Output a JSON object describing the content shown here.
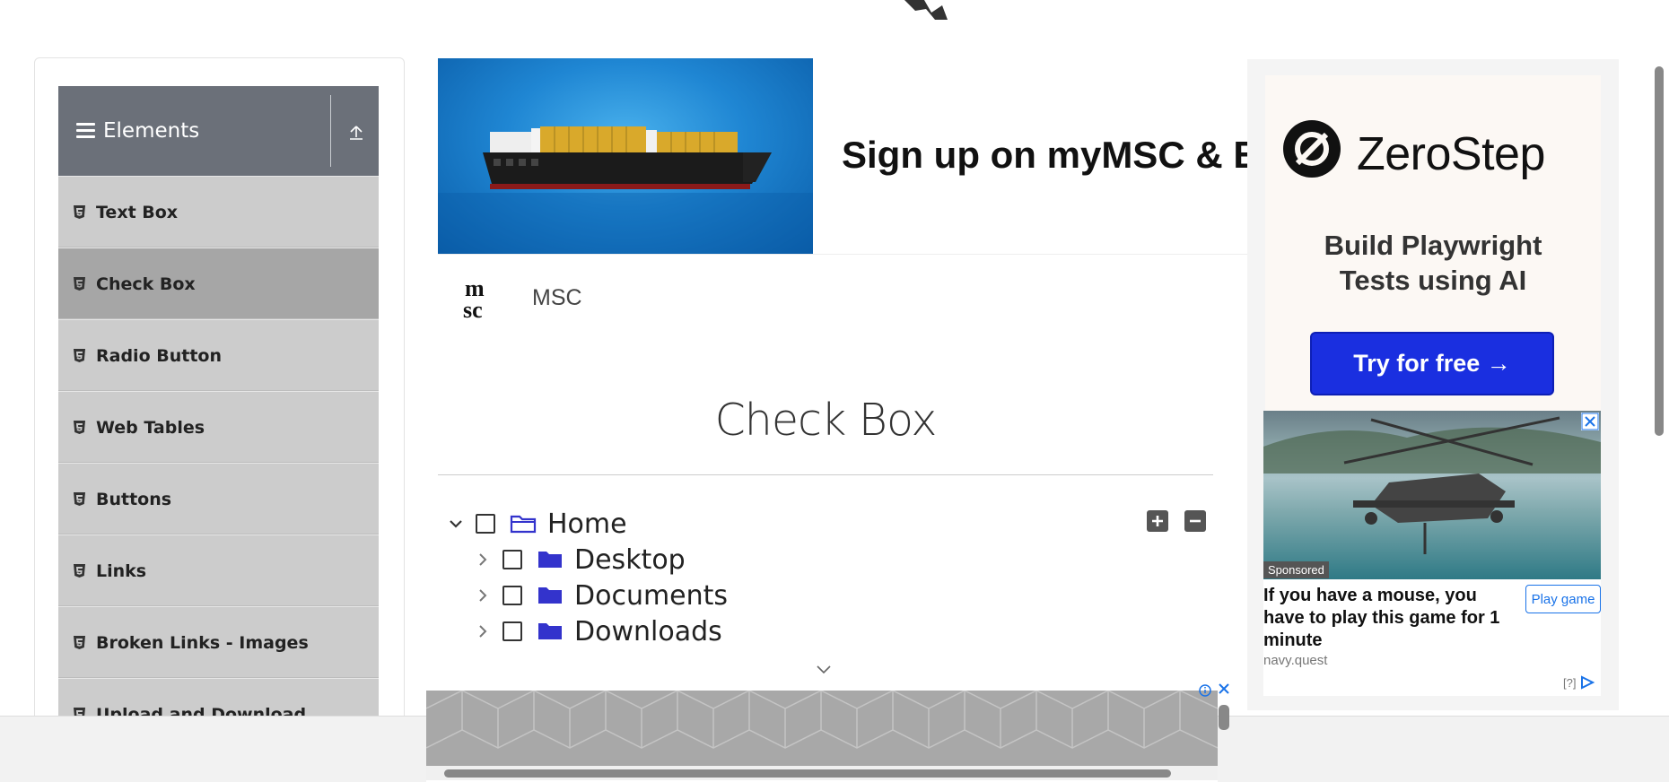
{
  "sidebar": {
    "group_title": "Elements",
    "items": [
      {
        "label": "Text Box"
      },
      {
        "label": "Check Box",
        "active": true
      },
      {
        "label": "Radio Button"
      },
      {
        "label": "Web Tables"
      },
      {
        "label": "Buttons"
      },
      {
        "label": "Links"
      },
      {
        "label": "Broken Links - Images"
      },
      {
        "label": "Upload and Download"
      }
    ]
  },
  "ad_banner": {
    "headline": "Sign up on myMSC & B",
    "brand": "MSC"
  },
  "main": {
    "title": "Check Box",
    "tree": {
      "root": {
        "label": "Home",
        "expanded": true,
        "checked": false
      },
      "children": [
        {
          "label": "Desktop",
          "expanded": false,
          "checked": false
        },
        {
          "label": "Documents",
          "expanded": false,
          "checked": false
        },
        {
          "label": "Downloads",
          "expanded": false,
          "checked": false
        }
      ]
    }
  },
  "right_ad": {
    "brand": "ZeroStep",
    "tagline_line1": "Build Playwright",
    "tagline_line2": "Tests using AI",
    "cta": "Try for free →",
    "sponsored": "Sponsored",
    "game_text": "If you have a mouse, you have to play this game for 1 minute",
    "play_button": "Play game",
    "domain": "navy.quest",
    "adchoices": "[?]"
  },
  "colors": {
    "sidebar_header": "#6b7079",
    "menu_item": "#cccccc",
    "menu_item_active": "#a6a6a6",
    "folder": "#3333cc",
    "zerostep_cta": "#1a2fe0",
    "link_blue": "#1a73e8"
  },
  "icons": {
    "sidebar_header": "hamburger-icon",
    "collapse": "upload-icon",
    "menu_item": "html5-icon",
    "tree_expand": "chevron-right-icon",
    "tree_collapse": "chevron-down-icon",
    "folder": "folder-icon",
    "expand_all": "plus-square-icon",
    "collapse_all": "minus-square-icon"
  }
}
